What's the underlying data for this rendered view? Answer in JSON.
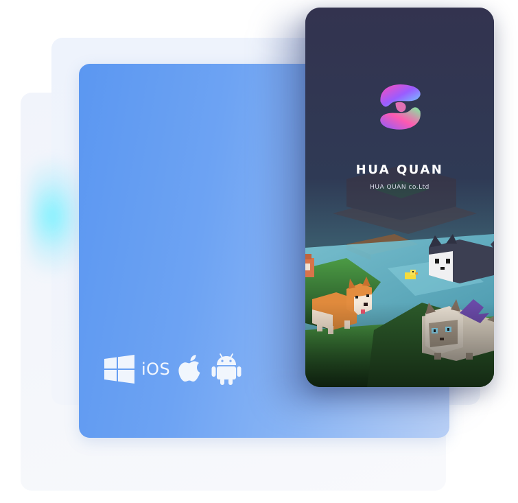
{
  "platforms": {
    "items": [
      "windows-icon",
      "ios-label",
      "apple-icon",
      "android-icon"
    ],
    "ios_label": "iOS"
  },
  "app": {
    "logo_icon": "swirl-logo-icon",
    "name": "HUA QUAN",
    "company": "HUA QUAN co.Ltd"
  },
  "colors": {
    "phone_background": "#33334f",
    "card_blue": "#5b97f1"
  }
}
